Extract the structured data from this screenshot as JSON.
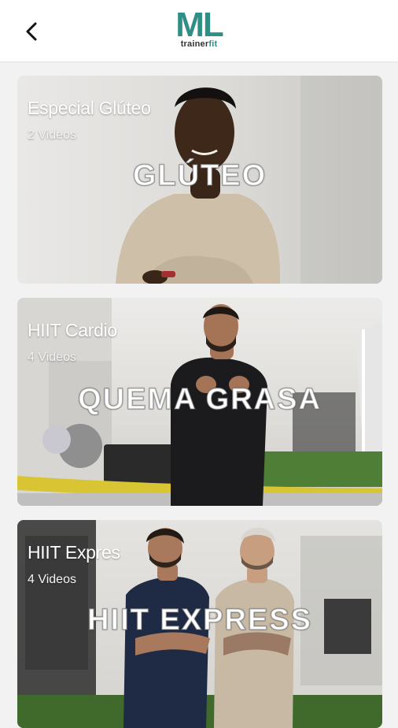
{
  "header": {
    "back_icon": "chevron-left-icon",
    "logo_mark": "ML",
    "logo_sub_main": "trainer",
    "logo_sub_accent": "fit"
  },
  "colors": {
    "brand": "#2f8f87",
    "background": "#f2f2f2",
    "header": "#ffffff"
  },
  "programs": [
    {
      "title": "Especial Glúteo",
      "count": "2 Videos",
      "overlay": "GLÚTEO"
    },
    {
      "title": "HIIT Cardio",
      "count": "4 Videos",
      "overlay": "QUEMA GRASA"
    },
    {
      "title": "HIIT Expres",
      "count": "4 Videos",
      "overlay": "HIIT EXPRESS"
    }
  ]
}
